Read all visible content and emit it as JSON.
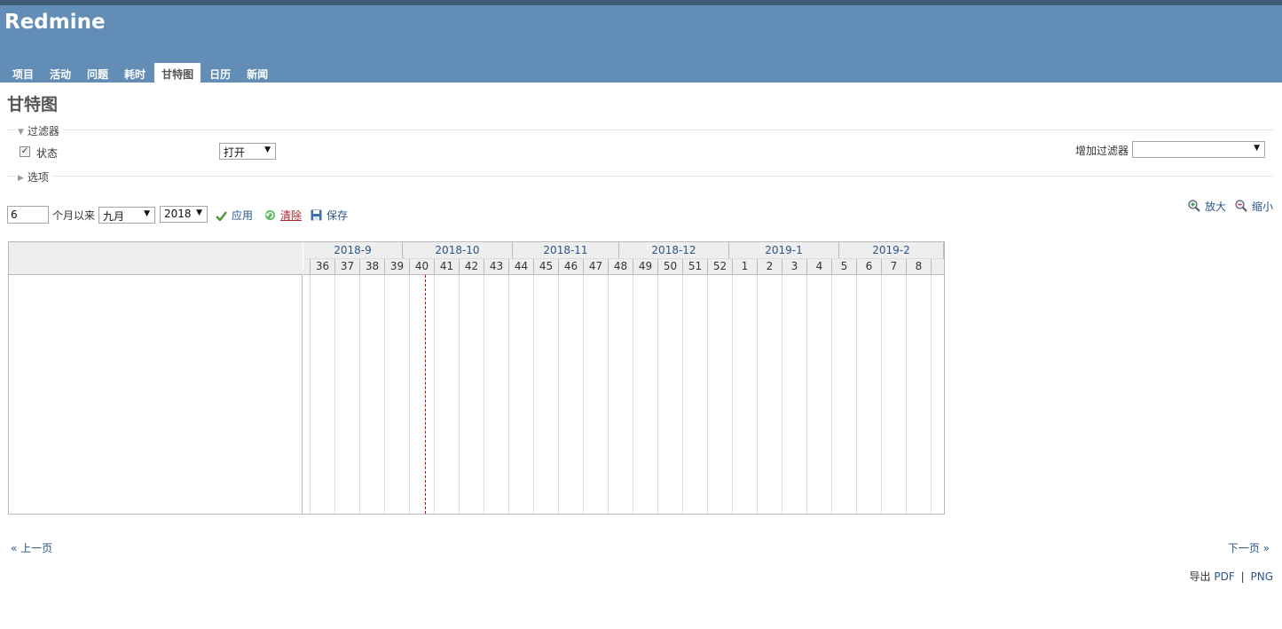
{
  "header": {
    "app_title": "Redmine"
  },
  "menu": [
    {
      "label": "项目",
      "selected": false
    },
    {
      "label": "活动",
      "selected": false
    },
    {
      "label": "问题",
      "selected": false
    },
    {
      "label": "耗时",
      "selected": false
    },
    {
      "label": "甘特图",
      "selected": true
    },
    {
      "label": "日历",
      "selected": false
    },
    {
      "label": "新闻",
      "selected": false
    }
  ],
  "page": {
    "title": "甘特图"
  },
  "filters": {
    "legend": "过滤器",
    "status_label": "状态",
    "status_checked": true,
    "status_value": "打开",
    "add_filter_label": "增加过滤器",
    "add_filter_value": ""
  },
  "options": {
    "legend": "选项"
  },
  "controls": {
    "months_value": "6",
    "months_since_label": "个月以来",
    "month_value": "九月",
    "year_value": "2018",
    "apply_label": "应用",
    "clear_label": "清除",
    "save_label": "保存",
    "zoom_in_label": "放大",
    "zoom_out_label": "缩小"
  },
  "gantt": {
    "months": [
      {
        "label": "2018-9",
        "weeks": 4
      },
      {
        "label": "2018-10",
        "weeks": 4.43
      },
      {
        "label": "2018-11",
        "weeks": 4.29
      },
      {
        "label": "2018-12",
        "weeks": 4.43
      },
      {
        "label": "2019-1",
        "weeks": 4.43
      },
      {
        "label": "2019-2",
        "weeks": 4.0
      }
    ],
    "weeks": [
      "",
      "36",
      "37",
      "38",
      "39",
      "40",
      "41",
      "42",
      "43",
      "44",
      "45",
      "46",
      "47",
      "48",
      "49",
      "50",
      "51",
      "52",
      "1",
      "2",
      "3",
      "4",
      "5",
      "6",
      "7",
      "8",
      ""
    ],
    "week_fractions": [
      0.29,
      1,
      1,
      1,
      1,
      1,
      1,
      1,
      1,
      1,
      1,
      1,
      1,
      1,
      1,
      1,
      1,
      1,
      1,
      1,
      1,
      1,
      1,
      1,
      1,
      1,
      0.57
    ],
    "today_week_fraction": 4.9
  },
  "pagination": {
    "prev_label": "« 上一页",
    "next_label": "下一页 »"
  },
  "export": {
    "label": "导出",
    "pdf_label": "PDF",
    "separator": "|",
    "png_label": "PNG"
  },
  "colors": {
    "header_bg": "#628db6",
    "header_strip": "#3e5b76",
    "link": "#2a5685",
    "today_line": "#cc0000"
  }
}
